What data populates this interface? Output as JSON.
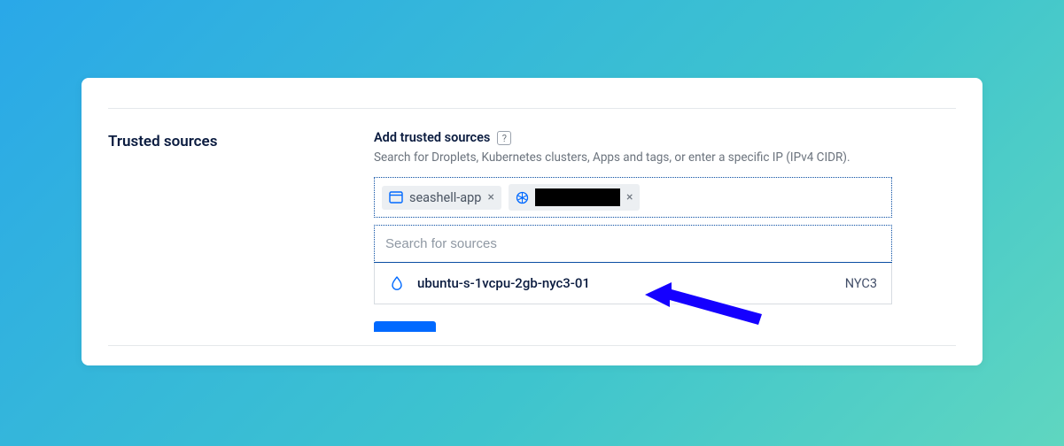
{
  "section": {
    "title": "Trusted sources"
  },
  "field": {
    "label": "Add trusted sources",
    "help_badge": "?",
    "help_text": "Search for Droplets, Kubernetes clusters, Apps and tags, or enter a specific IP (IPv4 CIDR)."
  },
  "chips": [
    {
      "icon": "app",
      "label": "seashell-app"
    },
    {
      "icon": "kubernetes",
      "label": "",
      "redacted": true
    }
  ],
  "search": {
    "placeholder": "Search for sources",
    "value": ""
  },
  "dropdown": {
    "items": [
      {
        "icon": "droplet",
        "name": "ubuntu-s-1vcpu-2gb-nyc3-01",
        "region": "NYC3"
      }
    ]
  }
}
